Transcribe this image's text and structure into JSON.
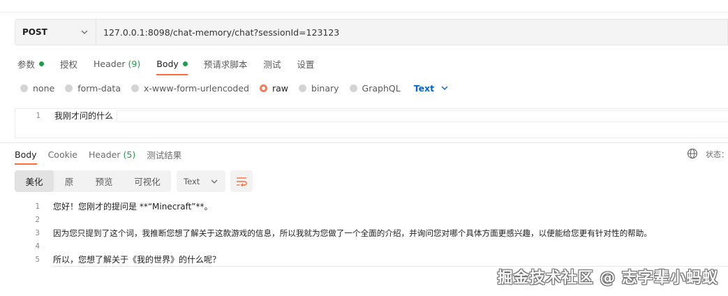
{
  "request": {
    "method": "POST",
    "url": "127.0.0.1:8098/chat-memory/chat?sessionId=123123"
  },
  "request_tabs": [
    {
      "label": "参数",
      "dot": true
    },
    {
      "label": "授权"
    },
    {
      "label": "Header",
      "count": "(9)"
    },
    {
      "label": "Body",
      "dot": true,
      "active": true
    },
    {
      "label": "预请求脚本"
    },
    {
      "label": "测试"
    },
    {
      "label": "设置"
    }
  ],
  "body_types": {
    "options": [
      "none",
      "form-data",
      "x-www-form-urlencoded",
      "raw",
      "binary",
      "GraphQL"
    ],
    "selected": "raw",
    "format": "Text"
  },
  "request_body": {
    "lines": [
      {
        "num": "1",
        "text": "我刚才问的什么"
      }
    ]
  },
  "response_tabs": [
    {
      "label": "Body",
      "active": true
    },
    {
      "label": "Cookie"
    },
    {
      "label": "Header",
      "count": "(5)"
    },
    {
      "label": "测试结果"
    }
  ],
  "status_label": "状态：",
  "view_modes": {
    "items": [
      "美化",
      "原",
      "预览",
      "可视化"
    ],
    "active": "美化",
    "format": "Text"
  },
  "response_body": {
    "lines": [
      {
        "num": "1",
        "text": "您好！您刚才的提问是 **“Minecraft”**。"
      },
      {
        "num": "2",
        "text": ""
      },
      {
        "num": "3",
        "text": "因为您只提到了这个词，我推断您想了解关于这款游戏的信息，所以我就为您做了一个全面的介绍，并询问您对哪个具体方面更感兴趣，以便能给您更有针对性的帮助。"
      },
      {
        "num": "4",
        "text": ""
      },
      {
        "num": "5",
        "text": "所以，您想了解关于《我的世界》的什么呢？"
      }
    ]
  },
  "watermark": "掘金技术社区 @ 志字辈小蚂蚁",
  "colors": {
    "accent": "#ff6c37",
    "green": "#1f9d4b",
    "link_blue": "#0265d2"
  }
}
